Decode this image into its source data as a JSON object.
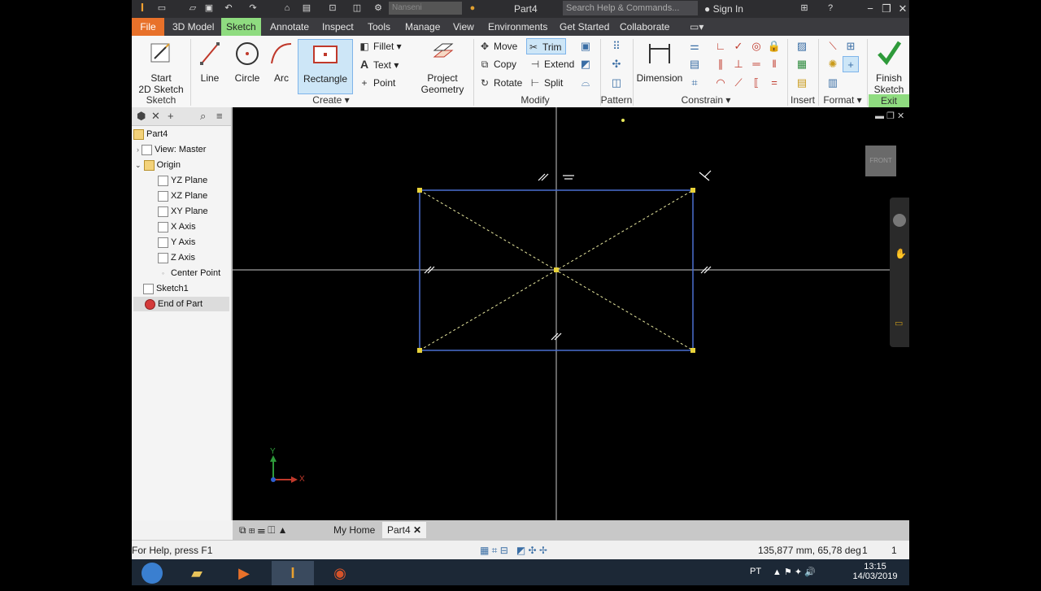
{
  "titlebar": {
    "app_icon": "I",
    "doc_name": "Part4",
    "style_combo": "Nanseni",
    "search_placeholder": "Search Help & Commands...",
    "sign_in": "Sign In",
    "min": "−",
    "max": "❐",
    "close": "✕"
  },
  "tabs": [
    "File",
    "3D Model",
    "Sketch",
    "Annotate",
    "Inspect",
    "Tools",
    "Manage",
    "View",
    "Environments",
    "Get Started",
    "Collaborate"
  ],
  "active_tab": "Sketch",
  "ribbon": {
    "start_sketch": "Start\n2D Sketch",
    "sketch_panel": "Sketch",
    "line": "Line",
    "circle": "Circle",
    "arc": "Arc",
    "rectangle": "Rectangle",
    "fillet": "Fillet",
    "text": "Text",
    "point": "Point",
    "create_panel": "Create",
    "project_geometry": "Project\nGeometry",
    "move": "Move",
    "copy": "Copy",
    "rotate": "Rotate",
    "trim": "Trim",
    "extend": "Extend",
    "split": "Split",
    "modify_panel": "Modify",
    "pattern_panel": "Pattern",
    "dimension": "Dimension",
    "constrain_panel": "Constrain",
    "insert_panel": "Insert",
    "format_panel": "Format",
    "finish_sketch": "Finish\nSketch",
    "exit_panel": "Exit"
  },
  "browser": {
    "items": [
      {
        "label": "Part4",
        "level": 0
      },
      {
        "label": "View: Master",
        "level": 1
      },
      {
        "label": "Origin",
        "level": 1
      },
      {
        "label": "YZ Plane",
        "level": 2
      },
      {
        "label": "XZ Plane",
        "level": 2
      },
      {
        "label": "XY Plane",
        "level": 2
      },
      {
        "label": "X Axis",
        "level": 2
      },
      {
        "label": "Y Axis",
        "level": 2
      },
      {
        "label": "Z Axis",
        "level": 2
      },
      {
        "label": "Center Point",
        "level": 2
      },
      {
        "label": "Sketch1",
        "level": 1
      },
      {
        "label": "End of Part",
        "level": 1
      }
    ]
  },
  "viewcube_label": "FRONT",
  "axis_triad": {
    "y": "Y",
    "x": "X"
  },
  "doc_tabs": {
    "home": "My Home",
    "part": "Part4"
  },
  "status": {
    "help": "For Help, press F1",
    "coords": "135,877 mm, 65,78 deg",
    "count1": "1",
    "count2": "1"
  },
  "taskbar": {
    "lang": "PT",
    "time": "13:15",
    "date": "14/03/2019"
  },
  "colors": {
    "file_tab": "#e8712a",
    "sketch_tab": "#8fdc80",
    "rect_line": "#4a6fd0",
    "handle": "#e8d23a"
  }
}
